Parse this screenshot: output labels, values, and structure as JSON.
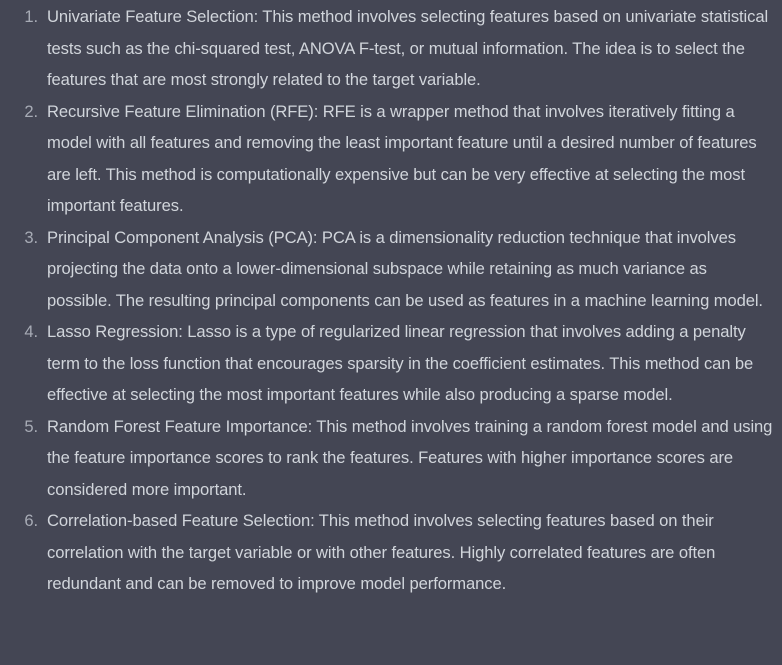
{
  "list": {
    "items": [
      {
        "number": "1.",
        "text": "Univariate Feature Selection: This method involves selecting features based on univariate statistical tests such as the chi-squared test, ANOVA F-test, or mutual information. The idea is to select the features that are most strongly related to the target variable."
      },
      {
        "number": "2.",
        "text": "Recursive Feature Elimination (RFE): RFE is a wrapper method that involves iteratively fitting a model with all features and removing the least important feature until a desired number of features are left. This method is computationally expensive but can be very effective at selecting the most important features."
      },
      {
        "number": "3.",
        "text": "Principal Component Analysis (PCA): PCA is a dimensionality reduction technique that involves projecting the data onto a lower-dimensional subspace while retaining as much variance as possible. The resulting principal components can be used as features in a machine learning model."
      },
      {
        "number": "4.",
        "text": "Lasso Regression: Lasso is a type of regularized linear regression that involves adding a penalty term to the loss function that encourages sparsity in the coefficient estimates. This method can be effective at selecting the most important features while also producing a sparse model."
      },
      {
        "number": "5.",
        "text": "Random Forest Feature Importance: This method involves training a random forest model and using the feature importance scores to rank the features. Features with higher importance scores are considered more important."
      },
      {
        "number": "6.",
        "text": "Correlation-based Feature Selection: This method involves selecting features based on their correlation with the target variable or with other features. Highly correlated features are often redundant and can be removed to improve model performance."
      }
    ]
  }
}
